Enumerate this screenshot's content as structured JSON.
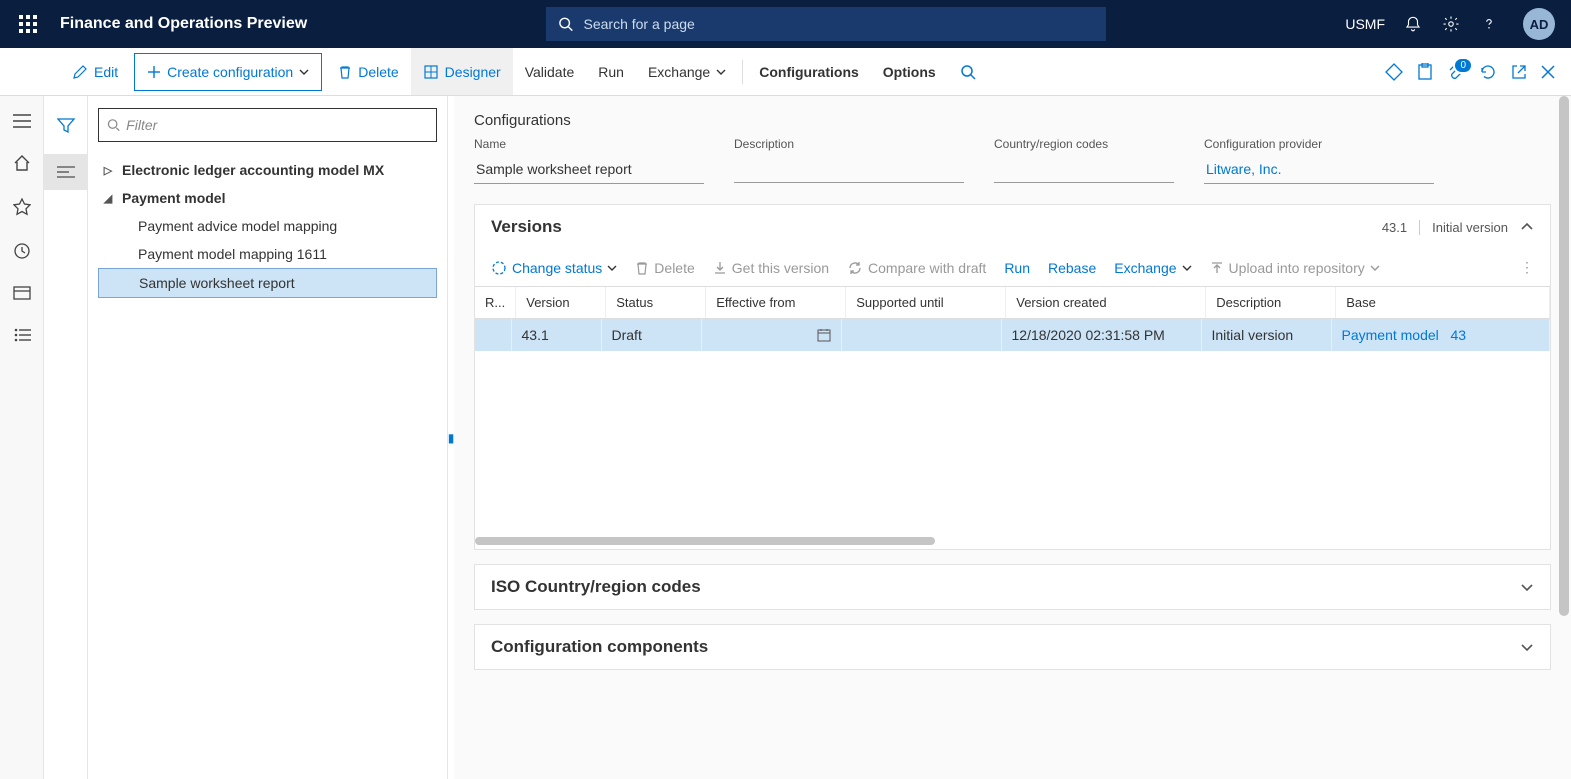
{
  "header": {
    "app_title": "Finance and Operations Preview",
    "search_placeholder": "Search for a page",
    "company": "USMF",
    "avatar": "AD"
  },
  "toolbar": {
    "edit": "Edit",
    "create": "Create configuration",
    "delete": "Delete",
    "designer": "Designer",
    "validate": "Validate",
    "run": "Run",
    "exchange": "Exchange",
    "configurations": "Configurations",
    "options": "Options",
    "attachments_badge": "0"
  },
  "filter": {
    "placeholder": "Filter"
  },
  "tree": {
    "node0": "Electronic ledger accounting model MX",
    "node1": "Payment model",
    "node1_0": "Payment advice model mapping",
    "node1_1": "Payment model mapping 1611",
    "node1_2": "Sample worksheet report"
  },
  "main": {
    "breadcrumb": "Configurations",
    "name_label": "Name",
    "name_value": "Sample worksheet report",
    "desc_label": "Description",
    "desc_value": "",
    "region_label": "Country/region codes",
    "region_value": "",
    "provider_label": "Configuration provider",
    "provider_value": "Litware, Inc."
  },
  "versions": {
    "title": "Versions",
    "summary_version": "43.1",
    "summary_desc": "Initial version",
    "change_status": "Change status",
    "delete": "Delete",
    "get_version": "Get this version",
    "compare": "Compare with draft",
    "run": "Run",
    "rebase": "Rebase",
    "exchange": "Exchange",
    "upload": "Upload into repository",
    "cols": {
      "r": "R...",
      "version": "Version",
      "status": "Status",
      "effective": "Effective from",
      "supported": "Supported until",
      "created": "Version created",
      "description": "Description",
      "base": "Base"
    },
    "row": {
      "version": "43.1",
      "status": "Draft",
      "effective": "",
      "supported": "",
      "created": "12/18/2020 02:31:58 PM",
      "description": "Initial version",
      "base": "Payment model",
      "base_ver": "43"
    }
  },
  "iso_section": "ISO Country/region codes",
  "components_section": "Configuration components"
}
